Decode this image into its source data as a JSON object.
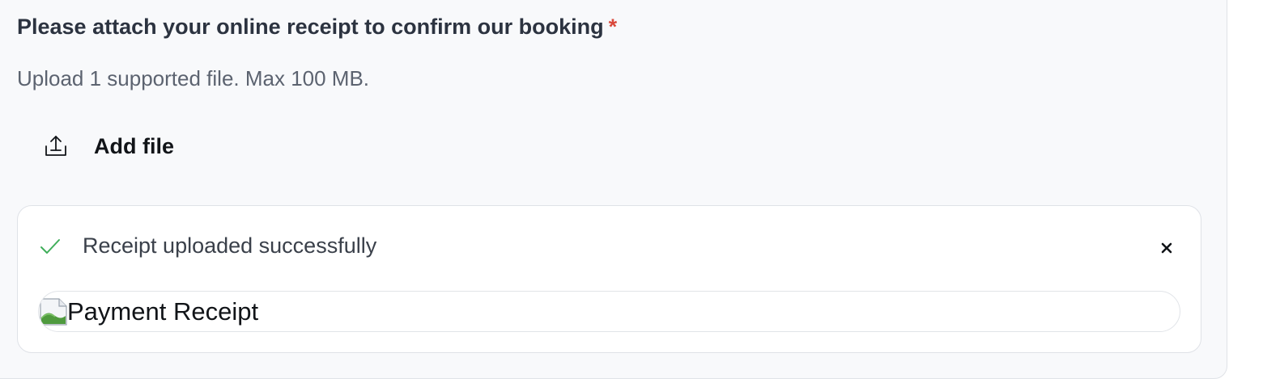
{
  "form": {
    "question": "Please attach your online receipt to confirm our booking",
    "required_marker": "*",
    "hint": "Upload 1 supported file. Max 100 MB.",
    "add_file_label": "Add file"
  },
  "upload": {
    "status_text": "Receipt uploaded successfully",
    "close_symbol": "×",
    "file_alt": "Payment Receipt",
    "file_icon": "broken-image-icon"
  },
  "colors": {
    "panel_bg": "#f8f9fb",
    "required": "#d9483b",
    "success": "#3fae5a"
  }
}
